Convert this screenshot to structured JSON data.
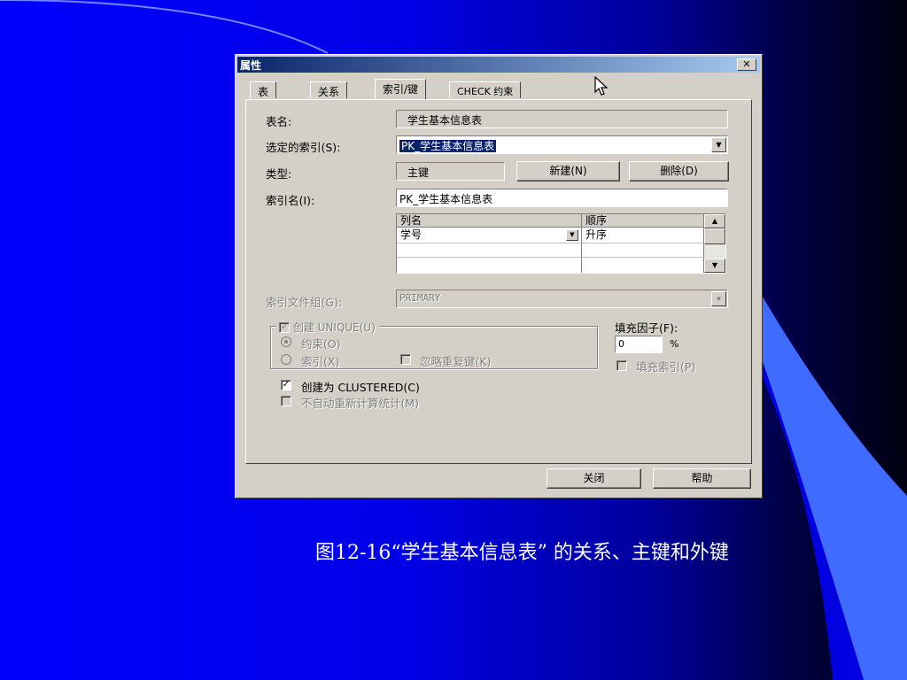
{
  "dialog": {
    "title": "属性",
    "close_label": "✕",
    "tabs": [
      {
        "label": "表"
      },
      {
        "label": "关系"
      },
      {
        "label": "索引/键"
      },
      {
        "label": "CHECK 约束"
      }
    ],
    "active_tab": 2,
    "table_name_label": "表名:",
    "table_name_value": "学生基本信息表",
    "selected_index_label": "选定的索引(S):",
    "selected_index_value": "PK_学生基本信息表",
    "type_label": "类型:",
    "type_value": "主键",
    "new_button": "新建(N)",
    "delete_button": "删除(D)",
    "index_name_label": "索引名(I):",
    "index_name_value": "PK_学生基本信息表",
    "columns_grid": {
      "headers": [
        "列名",
        "顺序"
      ],
      "rows": [
        [
          "学号",
          "升序"
        ]
      ]
    },
    "filegroup_label": "索引文件组(G):",
    "filegroup_value": "PRIMARY",
    "create_unique_label": "创建 UNIQUE(U)",
    "constraint_label": "约束(O)",
    "index_label": "索引(X)",
    "ignore_dup_label": "忽略重复键(K)",
    "fill_factor_label": "填充因子(F):",
    "fill_factor_value": "0",
    "percent_sign": "%",
    "pad_index_label": "填充索引(P)",
    "clustered_label": "创建为 CLUSTERED(C)",
    "no_recompute_label": "不自动重新计算统计(M)",
    "close_button": "关闭",
    "help_button": "帮助"
  },
  "caption": "图12-16“学生基本信息表” 的关系、主键和外键",
  "colors": {
    "slide_blue": "#0000ff",
    "title_bar": "#0a246a",
    "dialog_face": "#d4d0c8",
    "highlight": "#0a246a"
  }
}
